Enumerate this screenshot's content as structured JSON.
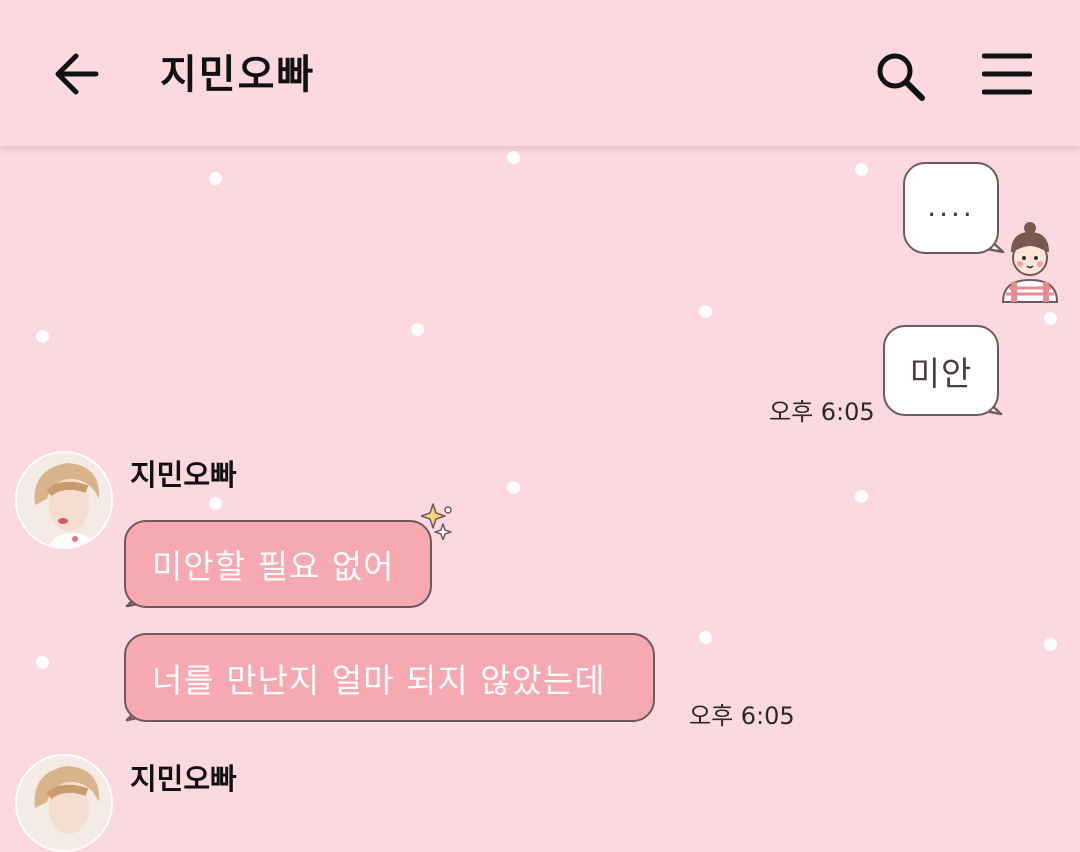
{
  "header": {
    "title": "지민오빠",
    "back_icon": "arrow-left-icon",
    "search_icon": "search-icon",
    "menu_icon": "hamburger-menu-icon"
  },
  "messages": [
    {
      "from": "me",
      "text": "....",
      "sticker": "girl-character-sticker"
    },
    {
      "from": "me",
      "text": "미안",
      "time": "오후 6:05"
    },
    {
      "from": "other",
      "sender": "지민오빠",
      "text": "미안할 필요 없어"
    },
    {
      "from": "other",
      "text": "너를 만난지 얼마 되지 않았는데",
      "time": "오후 6:05"
    },
    {
      "from": "other",
      "sender": "지민오빠"
    }
  ],
  "colors": {
    "background": "#fcd9e0",
    "my_bubble": "#ffffff",
    "their_bubble": "#f6a9b1",
    "bubble_border": "#6e5a5e"
  }
}
